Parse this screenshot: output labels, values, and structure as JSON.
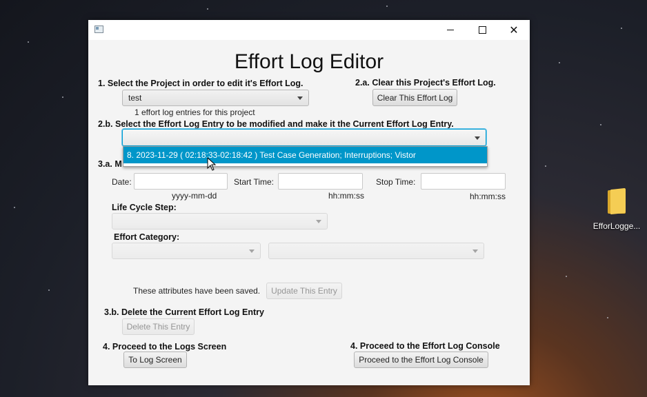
{
  "window": {
    "title": "",
    "controls": {
      "minimize": "minimize",
      "maximize": "maximize",
      "close": "close"
    }
  },
  "editor": {
    "heading": "Effort Log Editor",
    "step1_label": "1. Select the Project in order to edit it's Effort Log.",
    "project_value": "test",
    "entry_count_text": "1 effort log entries for this project",
    "step2a_label": "2.a. Clear this Project's Effort Log.",
    "clear_button": "Clear This Effort Log",
    "step2b_label": "2.b. Select the Effort Log Entry to be modified and make it the Current Effort Log Entry.",
    "entry_combo_value": "",
    "dropdown_option": "8. 2023-11-29 ( 02:18:33-02:18:42 ) Test Case Generation; Interruptions; Vistor",
    "step3a_label_visible": "3.a. M",
    "date_label": "Date:",
    "date_format": "yyyy-mm-dd",
    "start_label": "Start Time:",
    "start_format": "hh:mm:ss",
    "stop_label": "Stop Time:",
    "stop_format": "hh:mm:ss",
    "life_cycle_label": "Life Cycle Step:",
    "effort_category_label": "Effort Category:",
    "saved_status": "These attributes have been saved.",
    "update_button": "Update This Entry",
    "step3b_label": "3.b. Delete the Current Effort Log Entry",
    "delete_button": "Delete This Entry",
    "step4_logs_label": "4. Proceed to the Logs Screen",
    "to_log_button": "To Log Screen",
    "step4_console_label": "4. Proceed to the Effort Log Console",
    "console_button": "Proceed to the Effort Log Console"
  },
  "desktop": {
    "icon_label": "EfforLogge..."
  },
  "colors": {
    "selection": "#0096c9",
    "window_bg": "#f4f4f4",
    "focus": "#039ed3"
  }
}
